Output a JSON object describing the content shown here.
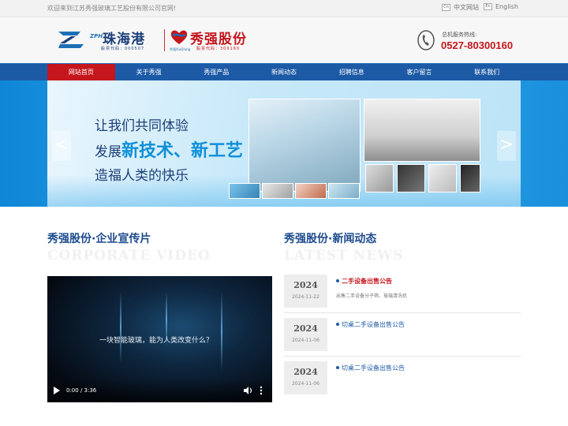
{
  "topbar": {
    "welcome": "欢迎来到江苏秀强玻璃工艺股份有限公司官网!",
    "lang_cn_icon": "Cn",
    "lang_cn": "中文网站",
    "lang_en_icon": "En",
    "lang_en": "English"
  },
  "header": {
    "logo1_mark": "ZPH",
    "logo1_name": "珠海港",
    "logo1_code": "股票代码：000507",
    "logo2_name": "秀强股份",
    "logo2_small": "秀强XiuQiang",
    "logo2_code": "股票代码：300160",
    "hotline_label": "总机服务热线:",
    "hotline_number": "0527-80300160"
  },
  "nav": {
    "items": [
      "网站首页",
      "关于秀强",
      "秀强产品",
      "新闻动态",
      "招聘信息",
      "客户留言",
      "联系我们"
    ]
  },
  "banner": {
    "line1": "让我们共同体验",
    "line2_prefix": "发展",
    "line2_highlight": "新技术、新工艺",
    "line3": "造福人类的快乐",
    "prev_icon": "<",
    "next_icon": ">"
  },
  "video_section": {
    "title": "秀强股份·企业宣传片",
    "title_en": "CORPORATE VIDEO",
    "caption": "一块智能玻璃，能为人类改变什么？",
    "time": "0:00 / 3:36"
  },
  "news_section": {
    "title": "秀强股份·新闻动态",
    "title_en": "LATEST NEWS",
    "items": [
      {
        "year": "2024",
        "date": "2024-11-22",
        "title": "二手设备出售公告",
        "desc": "出售二手设备分子筛、玻璃清洗机",
        "hot": true
      },
      {
        "year": "2024",
        "date": "2024-11-06",
        "title": "切桌二手设备出售公告",
        "desc": "",
        "hot": false
      },
      {
        "year": "2024",
        "date": "2024-11-06",
        "title": "切桌二手设备出售公告",
        "desc": "",
        "hot": false
      }
    ]
  },
  "colors": {
    "nav_bg": "#1d5aa6",
    "nav_active": "#c4161c",
    "brand_blue": "#1c4b8d",
    "brand_red": "#c4161c"
  }
}
